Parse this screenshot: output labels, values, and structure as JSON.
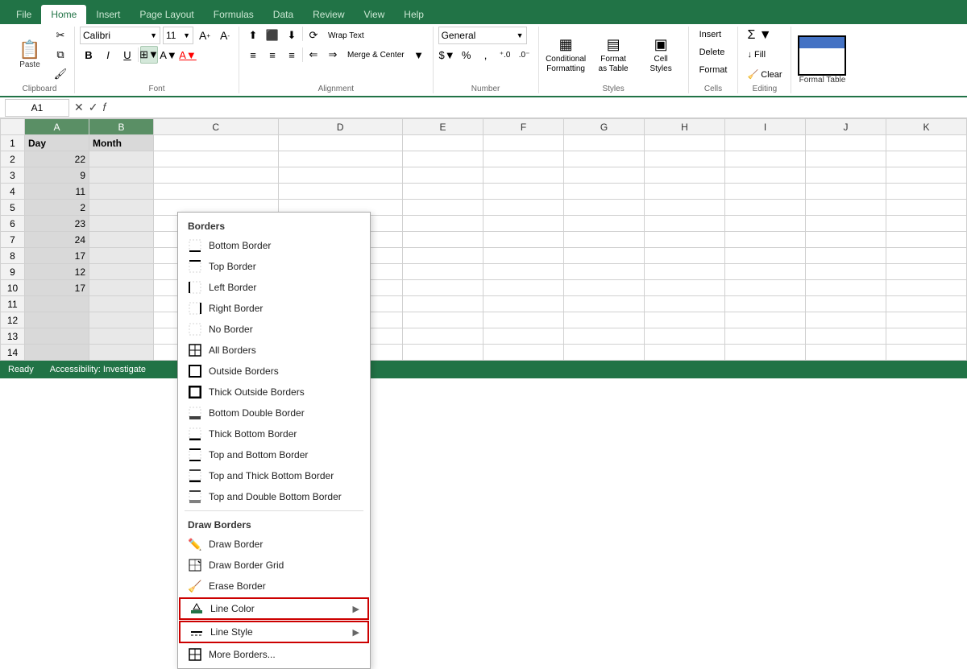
{
  "ribbon": {
    "tabs": [
      "File",
      "Home",
      "Insert",
      "Page Layout",
      "Formulas",
      "Data",
      "Review",
      "View",
      "Help"
    ],
    "active_tab": "Home"
  },
  "toolbar": {
    "clipboard_label": "Clipboard",
    "font_label": "Font",
    "alignment_label": "Alignment",
    "number_label": "Number",
    "styles_label": "Styles",
    "cells_label": "Cells",
    "editing_label": "Editing",
    "font_name": "Calibri",
    "font_size": "11",
    "bold": "B",
    "italic": "I",
    "underline": "U",
    "wrap_text": "Wrap Text",
    "merge_center": "Merge & Center",
    "number_format": "General",
    "conditional_formatting": "Conditional\nFormatting",
    "format_as_table": "Format as\nTable",
    "cell_styles": "Cell\nStyles",
    "insert": "Insert",
    "delete": "Delete",
    "format": "Format",
    "paste": "Paste",
    "borders_btn": "⊞"
  },
  "formula_bar": {
    "cell_ref": "A1",
    "value": ""
  },
  "grid": {
    "col_headers": [
      "",
      "A",
      "B",
      "C",
      "D",
      "E",
      "F",
      "G",
      "H",
      "I",
      "J",
      "K"
    ],
    "rows": [
      {
        "num": "1",
        "a": "Day",
        "b": "Month",
        "rest": [
          "",
          "",
          "",
          "",
          "",
          "",
          "",
          "",
          "",
          ""
        ]
      },
      {
        "num": "2",
        "a": "22",
        "b": "",
        "rest": [
          "",
          "",
          "",
          "",
          "",
          "",
          "",
          "",
          "",
          ""
        ]
      },
      {
        "num": "3",
        "a": "9",
        "b": "",
        "rest": [
          "",
          "",
          "",
          "",
          "",
          "",
          "",
          "",
          "",
          ""
        ]
      },
      {
        "num": "4",
        "a": "11",
        "b": "",
        "rest": [
          "",
          "",
          "",
          "",
          "",
          "",
          "",
          "",
          "",
          ""
        ]
      },
      {
        "num": "5",
        "a": "2",
        "b": "",
        "rest": [
          "",
          "",
          "",
          "",
          "",
          "",
          "",
          "",
          "",
          ""
        ]
      },
      {
        "num": "6",
        "a": "23",
        "b": "",
        "rest": [
          "",
          "",
          "",
          "",
          "",
          "",
          "",
          "",
          "",
          ""
        ]
      },
      {
        "num": "7",
        "a": "24",
        "b": "",
        "rest": [
          "",
          "",
          "",
          "",
          "",
          "",
          "",
          "",
          "",
          ""
        ]
      },
      {
        "num": "8",
        "a": "17",
        "b": "",
        "rest": [
          "",
          "",
          "",
          "",
          "",
          "",
          "",
          "",
          "",
          ""
        ]
      },
      {
        "num": "9",
        "a": "12",
        "b": "",
        "rest": [
          "",
          "",
          "",
          "",
          "",
          "",
          "",
          "",
          "",
          ""
        ]
      },
      {
        "num": "10",
        "a": "17",
        "b": "",
        "rest": [
          "",
          "",
          "",
          "",
          "",
          "",
          "",
          "",
          "",
          ""
        ]
      },
      {
        "num": "11",
        "a": "",
        "b": "",
        "rest": [
          "",
          "",
          "",
          "",
          "",
          "",
          "",
          "",
          "",
          ""
        ]
      },
      {
        "num": "12",
        "a": "",
        "b": "",
        "rest": [
          "",
          "",
          "",
          "",
          "",
          "",
          "",
          "",
          "",
          ""
        ]
      },
      {
        "num": "13",
        "a": "",
        "b": "",
        "rest": [
          "",
          "",
          "",
          "",
          "",
          "",
          "",
          "",
          "",
          ""
        ]
      },
      {
        "num": "14",
        "a": "",
        "b": "",
        "rest": [
          "",
          "",
          "",
          "",
          "",
          "",
          "",
          "",
          "",
          ""
        ]
      }
    ]
  },
  "borders_menu": {
    "title": "Borders",
    "items": [
      {
        "id": "bottom-border",
        "label": "Bottom Border",
        "icon": "bottom"
      },
      {
        "id": "top-border",
        "label": "Top Border",
        "icon": "top"
      },
      {
        "id": "left-border",
        "label": "Left Border",
        "icon": "left"
      },
      {
        "id": "right-border",
        "label": "Right Border",
        "icon": "right"
      },
      {
        "id": "no-border",
        "label": "No Border",
        "icon": "none"
      },
      {
        "id": "all-borders",
        "label": "All Borders",
        "icon": "all"
      },
      {
        "id": "outside-borders",
        "label": "Outside Borders",
        "icon": "outside"
      },
      {
        "id": "thick-outside",
        "label": "Thick Outside Borders",
        "icon": "thick-outside"
      },
      {
        "id": "bottom-double",
        "label": "Bottom Double Border",
        "icon": "bottom-double"
      },
      {
        "id": "thick-bottom",
        "label": "Thick Bottom Border",
        "icon": "thick-bottom"
      },
      {
        "id": "top-bottom",
        "label": "Top and Bottom Border",
        "icon": "top-bottom"
      },
      {
        "id": "top-thick-bottom",
        "label": "Top and Thick Bottom Border",
        "icon": "top-thick-bottom"
      },
      {
        "id": "top-double-bottom",
        "label": "Top and Double Bottom Border",
        "icon": "top-double-bottom"
      }
    ],
    "draw_title": "Draw Borders",
    "draw_items": [
      {
        "id": "draw-border",
        "label": "Draw Border",
        "icon": "pencil"
      },
      {
        "id": "draw-border-grid",
        "label": "Draw Border Grid",
        "icon": "grid-pencil"
      },
      {
        "id": "erase-border",
        "label": "Erase Border",
        "icon": "eraser"
      },
      {
        "id": "line-color",
        "label": "Line Color",
        "icon": "color-line",
        "arrow": true,
        "highlighted": true
      },
      {
        "id": "line-style",
        "label": "Line Style",
        "icon": "style-line",
        "arrow": true,
        "highlighted": true
      },
      {
        "id": "more-borders",
        "label": "More Borders...",
        "icon": "more"
      }
    ]
  },
  "status_bar": {
    "items": [
      "Ready",
      "Accessibility: Investigate"
    ]
  },
  "styles_menu": {
    "formal_table": "Formal Table"
  }
}
